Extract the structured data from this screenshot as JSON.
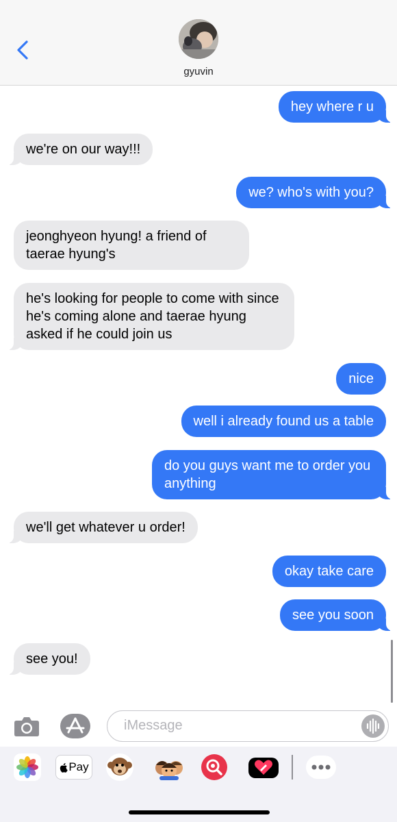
{
  "header": {
    "contact_name": "gyuvin"
  },
  "messages": [
    {
      "dir": "out",
      "text": "hey where r u"
    },
    {
      "dir": "in",
      "text": "we're on our way!!!"
    },
    {
      "dir": "out",
      "text": "we? who's with you?"
    },
    {
      "dir": "in",
      "text": "jeonghyeon hyung! a friend of taerae hyung's"
    },
    {
      "dir": "in",
      "text": "he's looking for people to come with since he's coming alone and taerae hyung asked if he could join us"
    },
    {
      "dir": "out",
      "text": "nice"
    },
    {
      "dir": "out",
      "text": "well i already found us a table"
    },
    {
      "dir": "out",
      "text": "do you guys want me to order you anything"
    },
    {
      "dir": "in",
      "text": "we'll get whatever u order!"
    },
    {
      "dir": "out",
      "text": "okay take care"
    },
    {
      "dir": "out",
      "text": "see you soon"
    },
    {
      "dir": "in",
      "text": "see you!"
    }
  ],
  "composer": {
    "placeholder": "iMessage"
  },
  "app_drawer": {
    "apple_pay_label": "Pay",
    "icons": [
      "photos-icon",
      "apple-pay-icon",
      "memoji-monkey-icon",
      "memoji-stickers-icon",
      "image-search-icon",
      "digital-touch-icon",
      "more-apps-icon"
    ]
  },
  "colors": {
    "outgoing_bubble": "#3478f6",
    "incoming_bubble": "#e9e9eb",
    "accent": "#3478f6"
  }
}
